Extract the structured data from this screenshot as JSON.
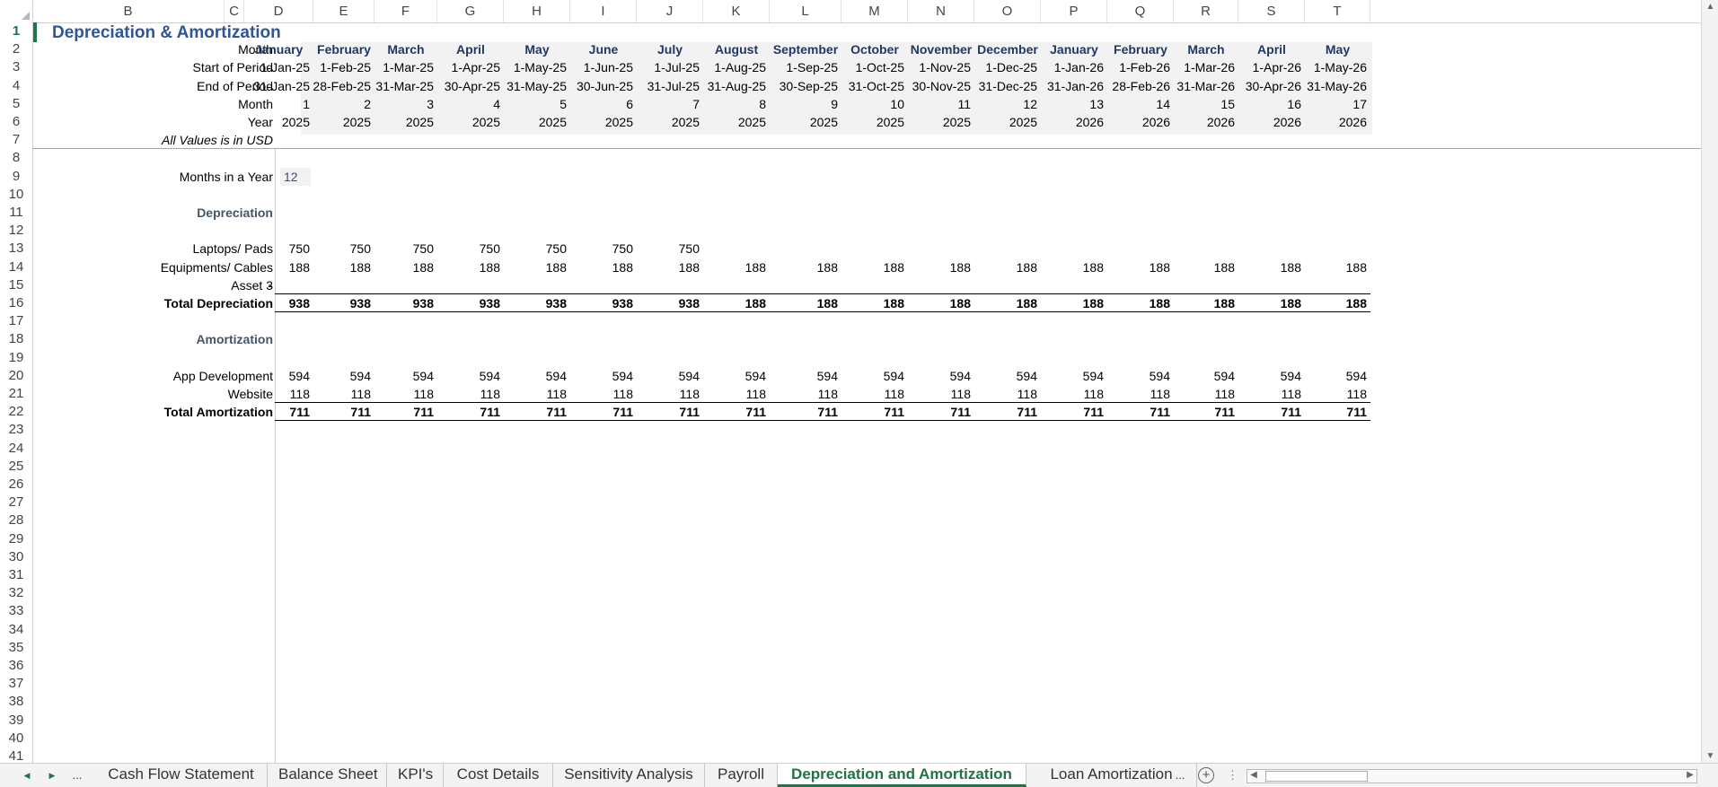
{
  "columns": [
    "B",
    "C",
    "D",
    "E",
    "F",
    "G",
    "H",
    "I",
    "J",
    "K",
    "L",
    "M",
    "N",
    "O",
    "P",
    "Q",
    "R",
    "S",
    "T"
  ],
  "rows": 41,
  "selected_row": "1",
  "title": "Depreciation & Amortization",
  "header_labels": {
    "month": "Month",
    "start": "Start of Period",
    "end": "End of Period",
    "month_num": "Month",
    "year": "Year",
    "units": "All Values is in USD"
  },
  "months": [
    "January",
    "February",
    "March",
    "April",
    "May",
    "June",
    "July",
    "August",
    "September",
    "October",
    "November",
    "December",
    "January",
    "February",
    "March",
    "April",
    "May"
  ],
  "start_dates": [
    "1-Jan-25",
    "1-Feb-25",
    "1-Mar-25",
    "1-Apr-25",
    "1-May-25",
    "1-Jun-25",
    "1-Jul-25",
    "1-Aug-25",
    "1-Sep-25",
    "1-Oct-25",
    "1-Nov-25",
    "1-Dec-25",
    "1-Jan-26",
    "1-Feb-26",
    "1-Mar-26",
    "1-Apr-26",
    "1-May-26"
  ],
  "end_dates": [
    "31-Jan-25",
    "28-Feb-25",
    "31-Mar-25",
    "30-Apr-25",
    "31-May-25",
    "30-Jun-25",
    "31-Jul-25",
    "31-Aug-25",
    "30-Sep-25",
    "31-Oct-25",
    "30-Nov-25",
    "31-Dec-25",
    "31-Jan-26",
    "28-Feb-26",
    "31-Mar-26",
    "30-Apr-26",
    "31-May-26"
  ],
  "month_numbers": [
    "1",
    "2",
    "3",
    "4",
    "5",
    "6",
    "7",
    "8",
    "9",
    "10",
    "11",
    "12",
    "13",
    "14",
    "15",
    "16",
    "17"
  ],
  "years": [
    "2025",
    "2025",
    "2025",
    "2025",
    "2025",
    "2025",
    "2025",
    "2025",
    "2025",
    "2025",
    "2025",
    "2025",
    "2026",
    "2026",
    "2026",
    "2026",
    "2026"
  ],
  "months_in_year": {
    "label": "Months in  a Year",
    "value": "12"
  },
  "depreciation": {
    "heading": "Depreciation",
    "items": [
      {
        "label": "Laptops/ Pads",
        "values": [
          "750",
          "750",
          "750",
          "750",
          "750",
          "750",
          "750",
          "",
          "",
          "",
          "",
          "",
          "",
          "",
          "",
          "",
          ""
        ]
      },
      {
        "label": "Equipments/ Cables",
        "values": [
          "188",
          "188",
          "188",
          "188",
          "188",
          "188",
          "188",
          "188",
          "188",
          "188",
          "188",
          "188",
          "188",
          "188",
          "188",
          "188",
          "188"
        ]
      },
      {
        "label": "Asset 3",
        "values": [
          "-",
          "",
          "",
          "",
          "",
          "",
          "",
          "",
          "",
          "",
          "",
          "",
          "",
          "",
          "",
          "",
          ""
        ]
      }
    ],
    "total_label": "Total Depreciation",
    "totals": [
      "938",
      "938",
      "938",
      "938",
      "938",
      "938",
      "938",
      "188",
      "188",
      "188",
      "188",
      "188",
      "188",
      "188",
      "188",
      "188",
      "188"
    ]
  },
  "amortization": {
    "heading": "Amortization",
    "items": [
      {
        "label": "App Development",
        "values": [
          "594",
          "594",
          "594",
          "594",
          "594",
          "594",
          "594",
          "594",
          "594",
          "594",
          "594",
          "594",
          "594",
          "594",
          "594",
          "594",
          "594"
        ]
      },
      {
        "label": "Website",
        "values": [
          "118",
          "118",
          "118",
          "118",
          "118",
          "118",
          "118",
          "118",
          "118",
          "118",
          "118",
          "118",
          "118",
          "118",
          "118",
          "118",
          "118"
        ]
      }
    ],
    "total_label": "Total Amortization",
    "totals": [
      "711",
      "711",
      "711",
      "711",
      "711",
      "711",
      "711",
      "711",
      "711",
      "711",
      "711",
      "711",
      "711",
      "711",
      "711",
      "711",
      "711"
    ]
  },
  "sheet_tabs": [
    "Cash Flow Statement",
    "Balance Sheet",
    "KPI's",
    "Cost Details",
    "Sensitivity Analysis",
    "Payroll",
    "Depreciation and Amortization",
    "Loan Amortization"
  ],
  "active_tab": "Depreciation and Amortization",
  "tab_nav": {
    "prev": "◀",
    "next": "▶",
    "more": "...",
    "more_right": "...",
    "add": "+"
  },
  "accent_color": "#217346",
  "title_color": "#2f5597"
}
